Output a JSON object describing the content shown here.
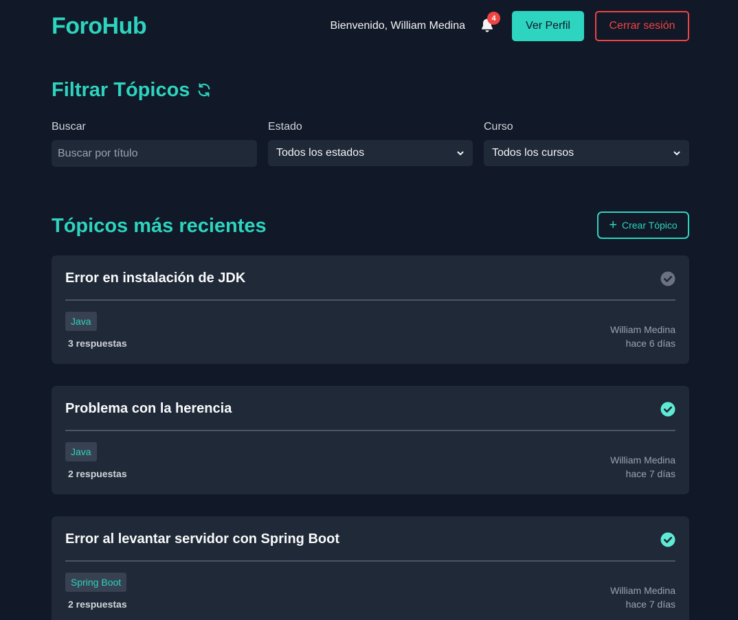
{
  "header": {
    "logo": "ForoHub",
    "welcome": "Bienvenido, William Medina",
    "notification_count": "4",
    "profile_button": "Ver Perfil",
    "logout_button": "Cerrar sesión"
  },
  "filters": {
    "title": "Filtrar Tópicos",
    "search": {
      "label": "Buscar",
      "placeholder": "Buscar por título",
      "value": ""
    },
    "status": {
      "label": "Estado",
      "selected": "Todos los estados"
    },
    "course": {
      "label": "Curso",
      "selected": "Todos los cursos"
    }
  },
  "topics": {
    "title": "Tópicos más recientes",
    "create_button": "Crear Tópico",
    "items": [
      {
        "title": "Error en instalación de JDK",
        "course": "Java",
        "replies": "3 respuestas",
        "author": "William Medina",
        "time": "hace 6 días",
        "solved": false
      },
      {
        "title": "Problema con la herencia",
        "course": "Java",
        "replies": "2 respuestas",
        "author": "William Medina",
        "time": "hace 7 días",
        "solved": true
      },
      {
        "title": "Error al levantar servidor con Spring Boot",
        "course": "Spring Boot",
        "replies": "2 respuestas",
        "author": "William Medina",
        "time": "hace 7 días",
        "solved": true
      }
    ]
  },
  "colors": {
    "background": "#111827",
    "card": "#1f2937",
    "accent": "#2dd4bf",
    "danger": "#ef4444",
    "check_solved": "#5eead4",
    "check_unsolved": "#6b7280"
  },
  "icons": {
    "notifications": "bell-icon",
    "refresh": "refresh-icon",
    "dropdown": "chevron-down-icon",
    "create": "plus-icon",
    "status": "check-circle-icon"
  }
}
